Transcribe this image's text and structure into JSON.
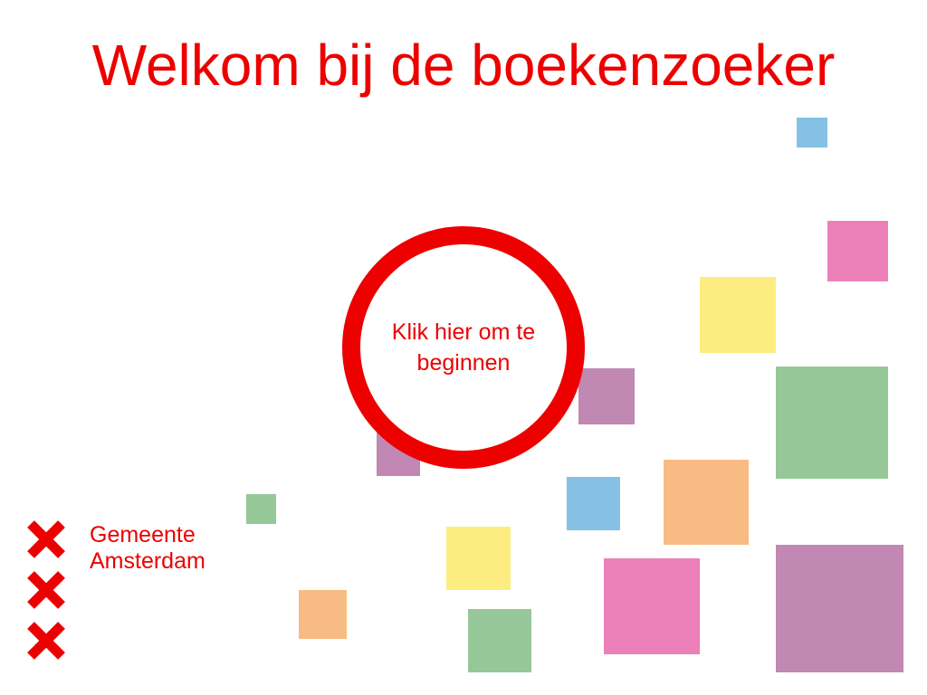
{
  "title": "Welkom bij de boekenzoeker",
  "start_button": {
    "label": "Klik hier om te beginnen"
  },
  "logo": {
    "icon": "amsterdam-xxx-icon",
    "org_name_line1": "Gemeente",
    "org_name_line2": "Amsterdam"
  },
  "colors": {
    "brand_red": "#ec0000",
    "blue": "#85c1e5",
    "pink": "#ec80b8",
    "yellow": "#fded80",
    "green": "#96c799",
    "orange": "#f8bb84",
    "purple": "#c088b3"
  }
}
